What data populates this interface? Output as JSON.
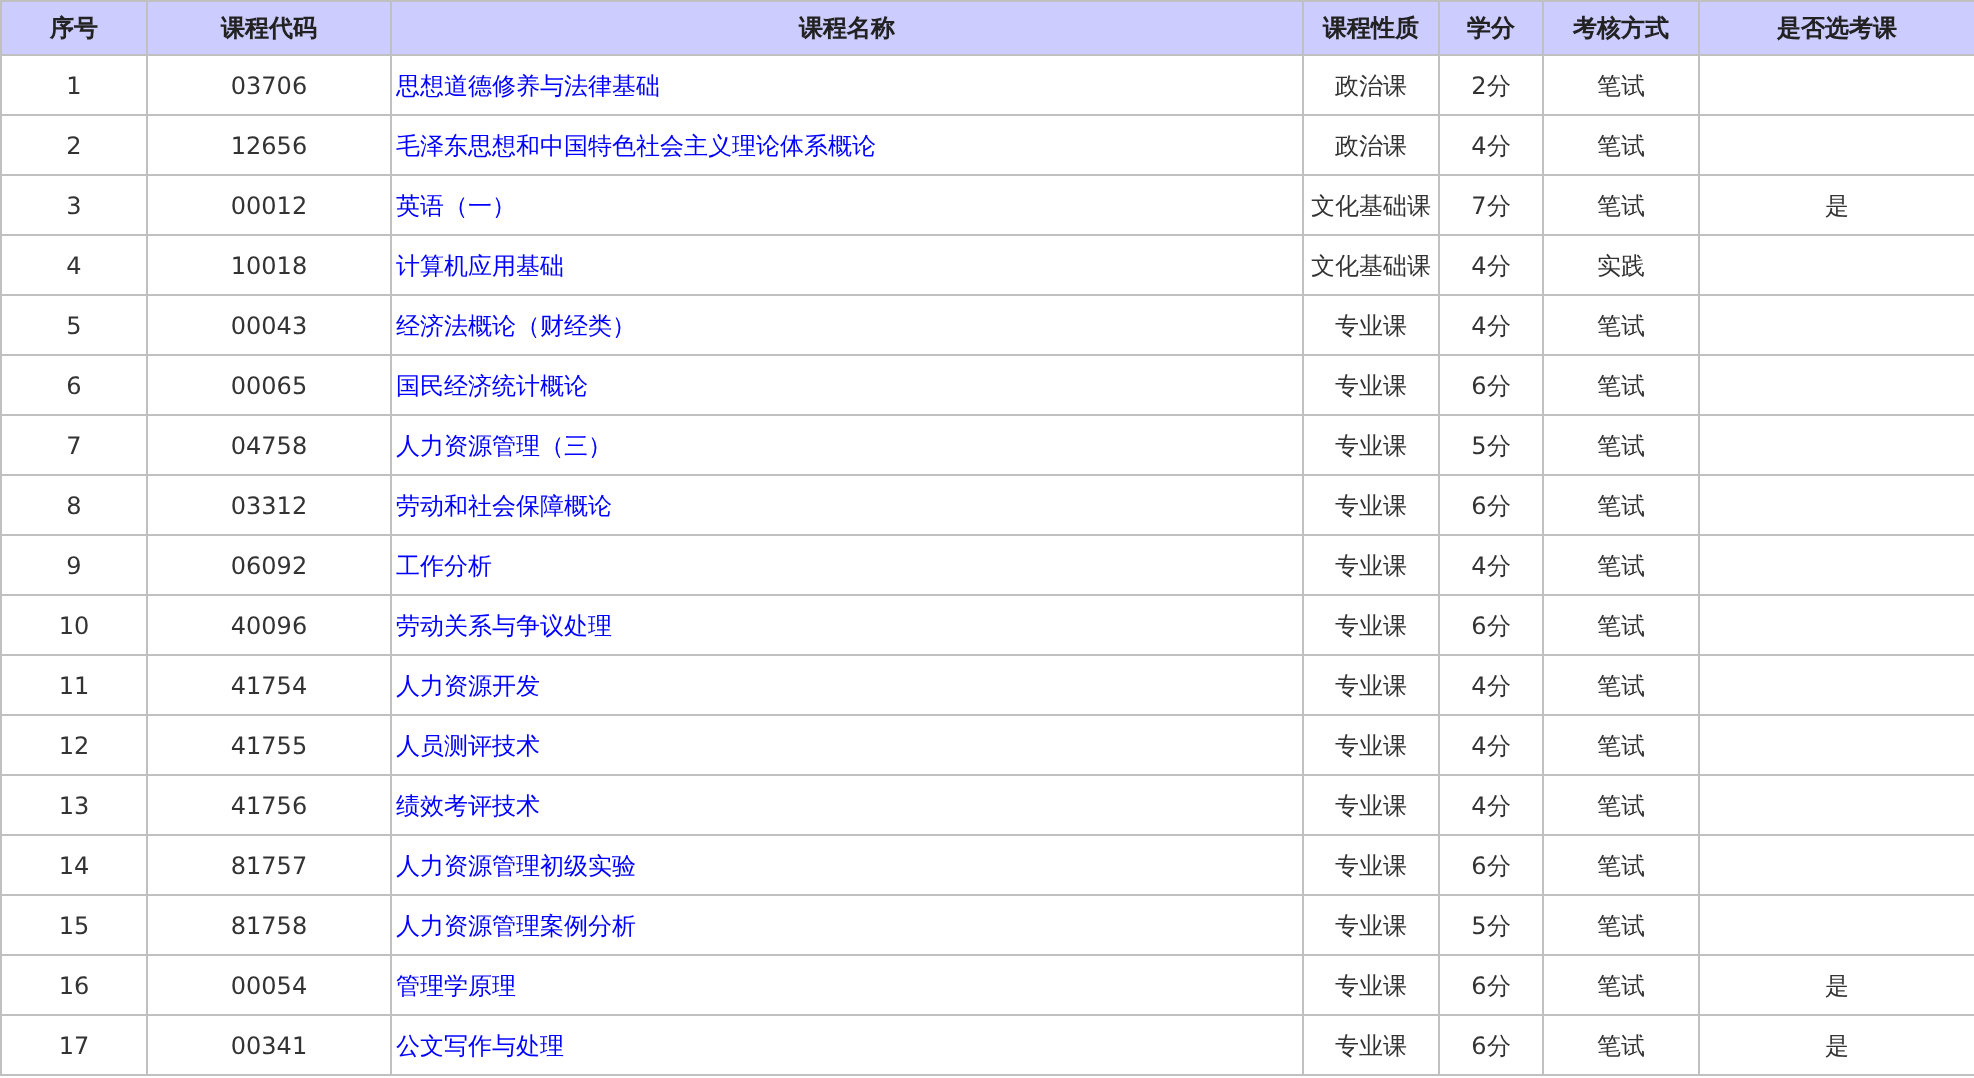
{
  "table": {
    "columns": [
      "序号",
      "课程代码",
      "课程名称",
      "课程性质",
      "学分",
      "考核方式",
      "是否选考课"
    ],
    "rows": [
      {
        "index": "1",
        "code": "03706",
        "name": "思想道德修养与法律基础",
        "type": "政治课",
        "credits": "2分",
        "exam": "笔试"
      },
      {
        "index": "2",
        "code": "12656",
        "name": "毛泽东思想和中国特色社会主义理论体系概论",
        "type": "政治课",
        "credits": "4分",
        "exam": "笔试"
      },
      {
        "index": "3",
        "code": "00012",
        "name": "英语（一）",
        "type": "文化基础课",
        "credits": "7分",
        "exam": "笔试",
        "elective": "是"
      },
      {
        "index": "4",
        "code": "10018",
        "name": "计算机应用基础",
        "type": "文化基础课",
        "credits": "4分",
        "exam": "实践"
      },
      {
        "index": "5",
        "code": "00043",
        "name": "经济法概论（财经类）",
        "type": "专业课",
        "credits": "4分",
        "exam": "笔试"
      },
      {
        "index": "6",
        "code": "00065",
        "name": "国民经济统计概论",
        "type": "专业课",
        "credits": "6分",
        "exam": "笔试"
      },
      {
        "index": "7",
        "code": "04758",
        "name": "人力资源管理（三）",
        "type": "专业课",
        "credits": "5分",
        "exam": "笔试"
      },
      {
        "index": "8",
        "code": "03312",
        "name": "劳动和社会保障概论",
        "type": "专业课",
        "credits": "6分",
        "exam": "笔试"
      },
      {
        "index": "9",
        "code": "06092",
        "name": "工作分析",
        "type": "专业课",
        "credits": "4分",
        "exam": "笔试"
      },
      {
        "index": "10",
        "code": "40096",
        "name": "劳动关系与争议处理",
        "type": "专业课",
        "credits": "6分",
        "exam": "笔试"
      },
      {
        "index": "11",
        "code": "41754",
        "name": "人力资源开发",
        "type": "专业课",
        "credits": "4分",
        "exam": "笔试"
      },
      {
        "index": "12",
        "code": "41755",
        "name": "人员测评技术",
        "type": "专业课",
        "credits": "4分",
        "exam": "笔试"
      },
      {
        "index": "13",
        "code": "41756",
        "name": "绩效考评技术",
        "type": "专业课",
        "credits": "4分",
        "exam": "笔试"
      },
      {
        "index": "14",
        "code": "81757",
        "name": "人力资源管理初级实验",
        "type": "专业课",
        "credits": "6分",
        "exam": "笔试"
      },
      {
        "index": "15",
        "code": "81758",
        "name": "人力资源管理案例分析",
        "type": "专业课",
        "credits": "5分",
        "exam": "笔试"
      },
      {
        "index": "16",
        "code": "00054",
        "name": "管理学原理",
        "type": "专业课",
        "credits": "6分",
        "exam": "笔试",
        "elective": "是"
      },
      {
        "index": "17",
        "code": "00341",
        "name": "公文写作与处理",
        "type": "专业课",
        "credits": "6分",
        "exam": "笔试",
        "elective": "是"
      }
    ]
  }
}
